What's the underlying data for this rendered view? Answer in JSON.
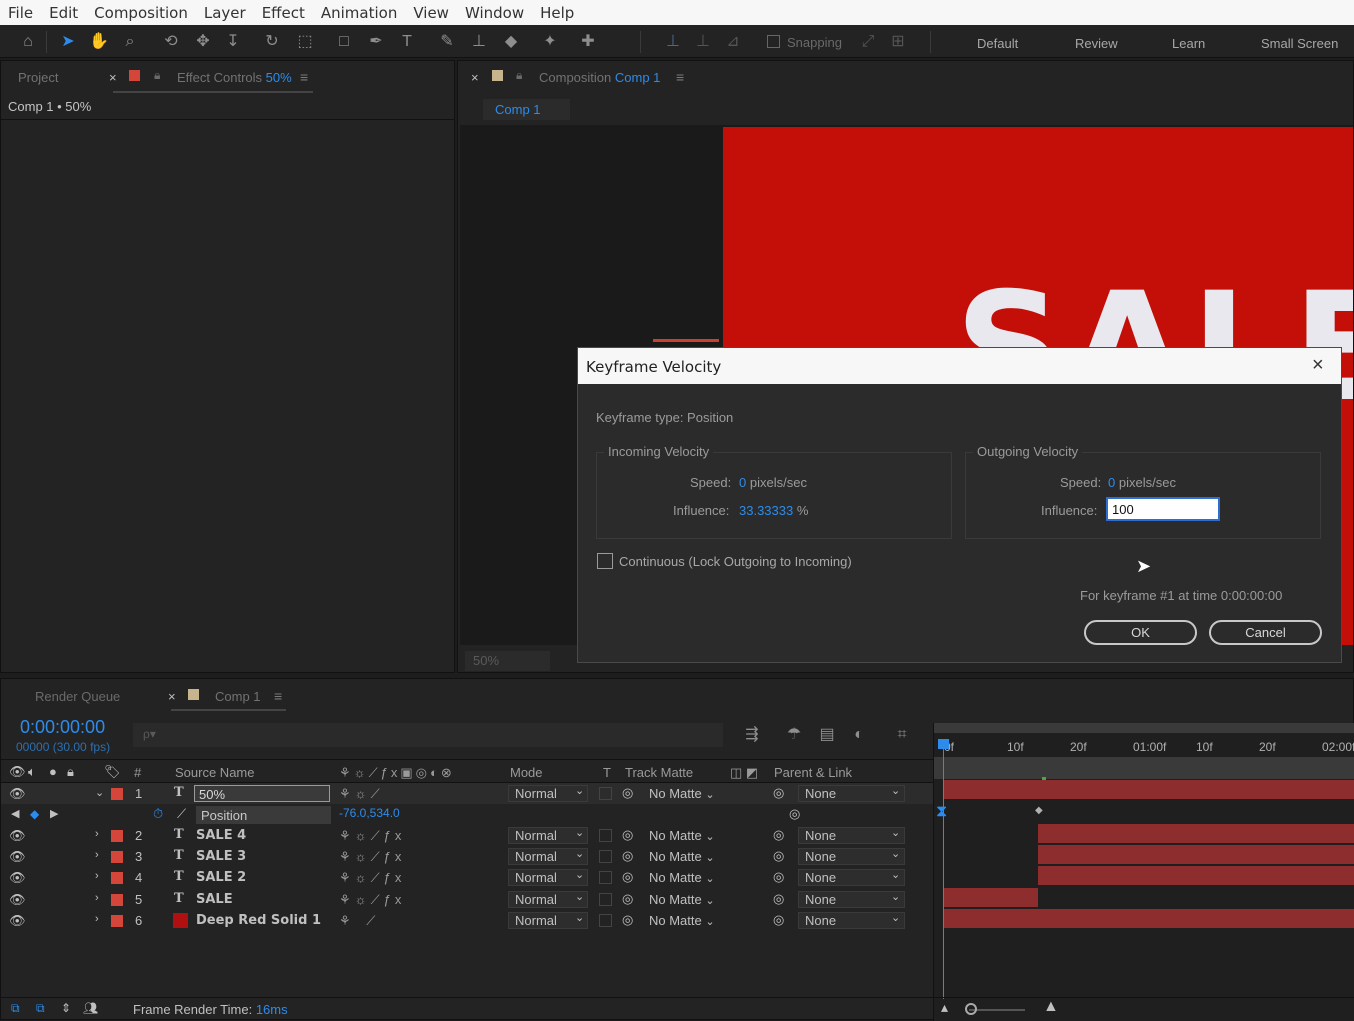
{
  "menu": [
    "File",
    "Edit",
    "Composition",
    "Layer",
    "Effect",
    "Animation",
    "View",
    "Window",
    "Help"
  ],
  "toolbar": {
    "snapping_label": "Snapping",
    "workspaces": [
      "Default",
      "Review",
      "Learn",
      "Small Screen"
    ]
  },
  "left_panel": {
    "tab_project": "Project",
    "tab_effect_controls": "Effect Controls",
    "effect_controls_target": "50%",
    "header": "Comp 1 • 50%"
  },
  "comp_panel": {
    "tab_label": "Composition",
    "tab_comp_name": "Comp 1",
    "subtab": "Comp 1",
    "zoom": "50%",
    "viewer_text": "SALE",
    "colors": {
      "viewer_red": "#c30f08",
      "text": "#e8e8ee"
    }
  },
  "dialog": {
    "title": "Keyframe Velocity",
    "keyframe_type": "Keyframe type: Position",
    "incoming": {
      "group_label": "Incoming Velocity",
      "speed_label": "Speed:",
      "speed_value": "0",
      "speed_unit": "pixels/sec",
      "influence_label": "Influence:",
      "influence_value": "33.33333",
      "influence_unit": "%"
    },
    "outgoing": {
      "group_label": "Outgoing Velocity",
      "speed_label": "Speed:",
      "speed_value": "0",
      "speed_unit": "pixels/sec",
      "influence_label": "Influence:",
      "influence_value": "100"
    },
    "continuous_label": "Continuous (Lock Outgoing to Incoming)",
    "continuous_checked": false,
    "footer_note": "For keyframe #1 at time 0:00:00:00",
    "ok_label": "OK",
    "cancel_label": "Cancel"
  },
  "timeline": {
    "tab_render_queue": "Render Queue",
    "tab_comp": "Comp 1",
    "timecode": "0:00:00:00",
    "frame_info": "00000 (30.00 fps)",
    "search_placeholder": "ρ▾",
    "ruler_labels": [
      "0f",
      "10f",
      "20f",
      "01:00f",
      "10f",
      "20f",
      "02:00f"
    ],
    "headers": {
      "num": "#",
      "source_name": "Source Name",
      "mode": "Mode",
      "t": "T",
      "track_matte": "Track Matte",
      "parent_link": "Parent & Link"
    },
    "layers": [
      {
        "num": "1",
        "type": "T",
        "name": "50%",
        "mode": "Normal",
        "matte": "No Matte",
        "parent": "None",
        "expanded": true
      },
      {
        "num": "2",
        "type": "T",
        "name": "SALE 4",
        "mode": "Normal",
        "matte": "No Matte",
        "parent": "None",
        "expanded": false
      },
      {
        "num": "3",
        "type": "T",
        "name": "SALE 3",
        "mode": "Normal",
        "matte": "No Matte",
        "parent": "None",
        "expanded": false
      },
      {
        "num": "4",
        "type": "T",
        "name": "SALE 2",
        "mode": "Normal",
        "matte": "No Matte",
        "parent": "None",
        "expanded": false
      },
      {
        "num": "5",
        "type": "T",
        "name": "SALE",
        "mode": "Normal",
        "matte": "No Matte",
        "parent": "None",
        "expanded": false
      },
      {
        "num": "6",
        "type": "solid",
        "name": "Deep Red Solid 1",
        "mode": "Normal",
        "matte": "No Matte",
        "parent": "None",
        "expanded": false
      }
    ],
    "position_property": {
      "label": "Position",
      "value": "-76.0,534.0"
    },
    "footer": {
      "label": "Frame Render Time:",
      "value": "16ms"
    },
    "colors": {
      "label_red": "#d4453a",
      "bar_red": "#8e2d2d",
      "accent_blue": "#2d8ceb",
      "timecode_blue": "#2d8ceb"
    }
  }
}
